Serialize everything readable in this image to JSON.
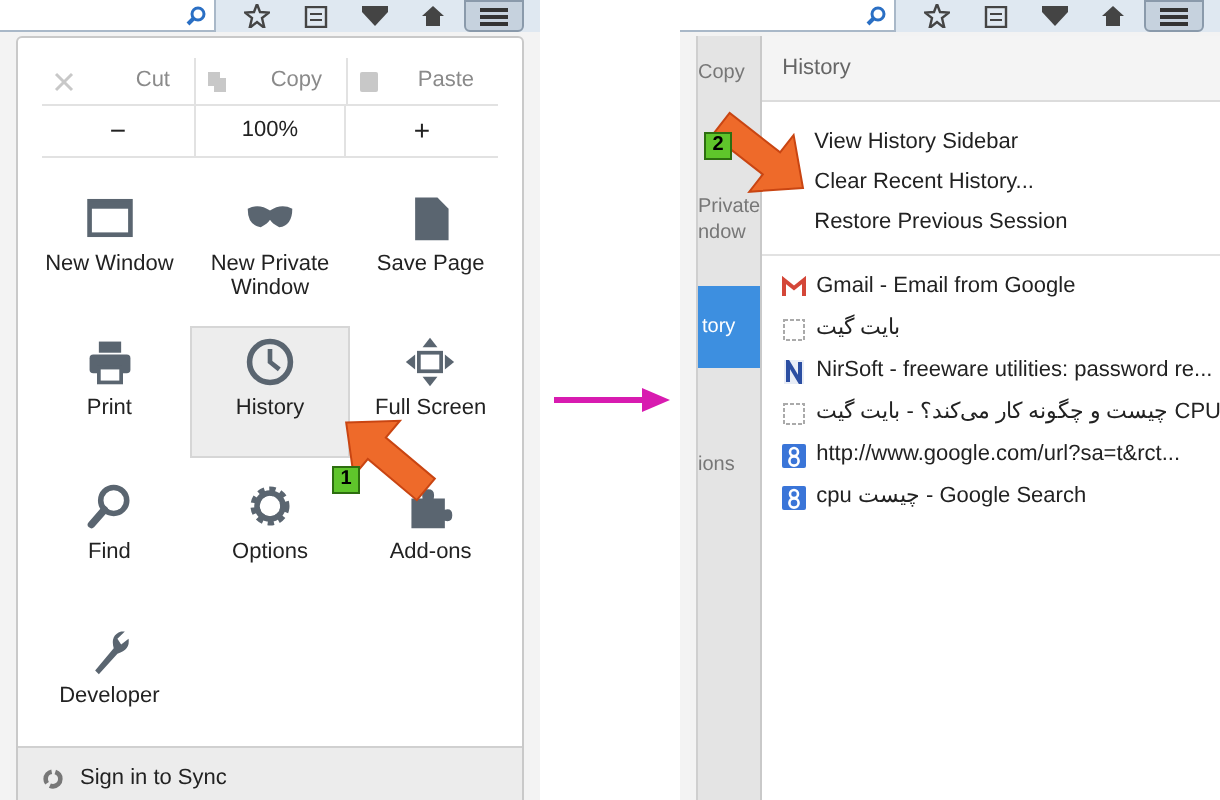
{
  "left": {
    "edit_row": [
      {
        "kind": "cut",
        "label": "Cut",
        "disabled": true
      },
      {
        "kind": "copy",
        "label": "Copy",
        "disabled": true
      },
      {
        "kind": "paste",
        "label": "Paste",
        "disabled": true
      }
    ],
    "zoom_row": {
      "minus": "−",
      "level": "100%",
      "plus": "+"
    },
    "items": [
      {
        "kind": "window",
        "label": "New Window",
        "selected": false
      },
      {
        "kind": "mask",
        "label": "New Private Window",
        "selected": false
      },
      {
        "kind": "page",
        "label": "Save Page",
        "selected": false
      },
      {
        "kind": "print",
        "label": "Print",
        "selected": false
      },
      {
        "kind": "clock",
        "label": "History",
        "selected": true
      },
      {
        "kind": "fullscreen",
        "label": "Full Screen",
        "selected": false
      },
      {
        "kind": "search",
        "label": "Find",
        "selected": false
      },
      {
        "kind": "gear",
        "label": "Options",
        "selected": false
      },
      {
        "kind": "puzzle",
        "label": "Add-ons",
        "selected": false
      },
      {
        "kind": "wrench",
        "label": "Developer",
        "selected": false
      }
    ],
    "footer": "Sign in to Sync",
    "step_badge": "1"
  },
  "right": {
    "behind": [
      {
        "text": "Copy",
        "selected": false
      },
      {
        "text": "Private",
        "selected": false
      },
      {
        "text": "ndow",
        "selected": false
      },
      {
        "text": "tory",
        "selected": true
      },
      {
        "text": "ions",
        "selected": false
      }
    ],
    "header": "History",
    "actions": [
      "View History Sidebar",
      "Clear Recent History...",
      "Restore Previous Session"
    ],
    "entries": [
      {
        "kind": "gmail",
        "title": "Gmail - Email from Google"
      },
      {
        "kind": "blank",
        "title": "بایت گیت"
      },
      {
        "kind": "nirsoft",
        "title": "NirSoft - freeware utilities: password re..."
      },
      {
        "kind": "blank",
        "title": "CPU چیست و چگونه کار می‌کند؟ - بایت گیت"
      },
      {
        "kind": "google",
        "title": "http://www.google.com/url?sa=t&rct..."
      },
      {
        "kind": "google",
        "title": "cpu چیست - Google Search"
      }
    ],
    "step_badge": "2"
  }
}
